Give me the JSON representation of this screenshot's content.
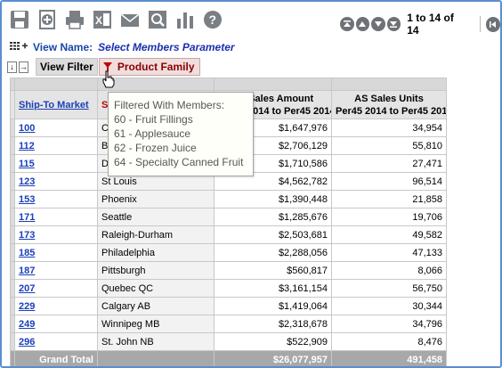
{
  "toolbar": {
    "icons": [
      "save-icon",
      "add-icon",
      "print-icon",
      "excel-icon",
      "email-icon",
      "search-icon",
      "chart-icon",
      "help-icon"
    ],
    "pager_text": "1 to 14 of 14"
  },
  "view": {
    "name_label": "View Name:",
    "name_value": "Select Members Parameter"
  },
  "filter": {
    "button_label": "View Filter",
    "family_label": "Product Family"
  },
  "tooltip": {
    "title": "Filtered With Members:",
    "members": [
      "60 - Fruit Fillings",
      "61 - Applesauce",
      "62 - Frozen Juice",
      "64 - Specialty Canned Fruit"
    ]
  },
  "table": {
    "col_header_market": "Ship-To Market",
    "col_header_name_initial": "S",
    "col_header_amount_line1": "AS Sales Amount",
    "col_header_amount_line2": "Per45 2014 to Per45 2014",
    "col_header_units_line1": "AS Sales Units",
    "col_header_units_line2": "Per45 2014 to Per45 2014",
    "rows": [
      {
        "code": "100",
        "name": "C",
        "amount": "$1,647,976",
        "units": "34,954"
      },
      {
        "code": "112",
        "name": "B",
        "amount": "$2,706,129",
        "units": "55,810"
      },
      {
        "code": "115",
        "name": "D",
        "amount": "$1,710,586",
        "units": "27,471"
      },
      {
        "code": "123",
        "name": "St Louis",
        "amount": "$4,562,782",
        "units": "96,514"
      },
      {
        "code": "153",
        "name": "Phoenix",
        "amount": "$1,390,448",
        "units": "21,858"
      },
      {
        "code": "171",
        "name": "Seattle",
        "amount": "$1,285,676",
        "units": "19,706"
      },
      {
        "code": "173",
        "name": "Raleigh-Durham",
        "amount": "$2,503,681",
        "units": "49,582"
      },
      {
        "code": "185",
        "name": "Philadelphia",
        "amount": "$2,288,056",
        "units": "47,133"
      },
      {
        "code": "187",
        "name": "Pittsburgh",
        "amount": "$560,817",
        "units": "8,066"
      },
      {
        "code": "207",
        "name": "Quebec QC",
        "amount": "$3,161,154",
        "units": "56,750"
      },
      {
        "code": "229",
        "name": "Calgary AB",
        "amount": "$1,419,064",
        "units": "30,344"
      },
      {
        "code": "249",
        "name": "Winnipeg MB",
        "amount": "$2,318,678",
        "units": "34,796"
      },
      {
        "code": "296",
        "name": "St. John NB",
        "amount": "$522,909",
        "units": "8,476"
      }
    ],
    "total": {
      "label": "Grand Total",
      "amount": "$26,077,957",
      "units": "491,458"
    }
  },
  "colors": {
    "border": "#5a8fd0",
    "link": "#1a3fb8",
    "filter_red": "#8b0000",
    "total_bg": "#a8a8a8"
  }
}
